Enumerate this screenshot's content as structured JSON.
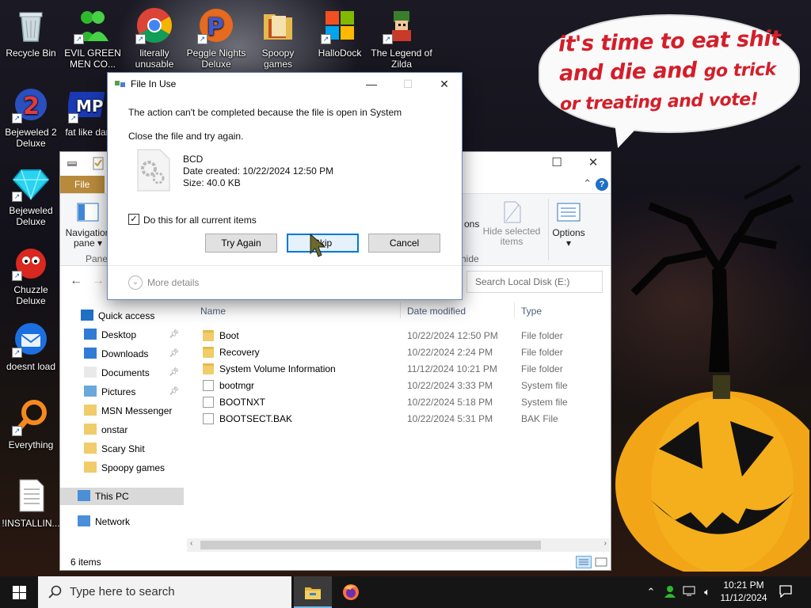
{
  "desktop": {
    "icons": [
      {
        "label": "Recycle Bin",
        "icon": "recycle-bin-icon"
      },
      {
        "label": "EVIL GREEN MEN CO...",
        "icon": "green-men-icon"
      },
      {
        "label": "literally unusable",
        "icon": "chrome-icon"
      },
      {
        "label": "Peggle Nights Deluxe",
        "icon": "peggle-icon"
      },
      {
        "label": "Spoopy games",
        "icon": "folder-icon"
      },
      {
        "label": "HalloDock",
        "icon": "windows-logo-icon"
      },
      {
        "label": "The Legend of Zilda",
        "icon": "zilda-icon"
      },
      {
        "label": "Bejeweled 2 Deluxe",
        "icon": "bejeweled2-icon"
      },
      {
        "label": "fat like dar",
        "icon": "mpi-icon"
      },
      {
        "label": "Bejeweled Deluxe",
        "icon": "bejeweled-icon"
      },
      {
        "label": "Chuzzle Deluxe",
        "icon": "chuzzle-icon"
      },
      {
        "label": "doesnt load",
        "icon": "thunderbird-icon"
      },
      {
        "label": "Everything",
        "icon": "everything-search-icon"
      },
      {
        "label": "!INSTALLIN...",
        "icon": "text-document-icon"
      }
    ],
    "wallpaper_caption_line1": "it's time to eat shit",
    "wallpaper_caption_line2a": "and die and",
    "wallpaper_caption_line2b": "go trick",
    "wallpaper_caption_line3": "or treating and vote!"
  },
  "explorer": {
    "file_tab": "File",
    "ribbon": {
      "nav_pane_line1": "Navigation",
      "nav_pane_line2": "pane ▾",
      "panes_group": "Panes",
      "options_partial": "ons",
      "hide_selected_line1": "Hide selected",
      "hide_selected_line2": "items",
      "hide_group_partial": "hide",
      "options": "Options"
    },
    "search_placeholder": "Search Local Disk (E:)",
    "columns": {
      "name": "Name",
      "date": "Date modified",
      "type": "Type"
    },
    "nav": {
      "quick_access": "Quick access",
      "items": [
        {
          "label": "Desktop",
          "pinned": true
        },
        {
          "label": "Downloads",
          "pinned": true
        },
        {
          "label": "Documents",
          "pinned": true
        },
        {
          "label": "Pictures",
          "pinned": true
        },
        {
          "label": "MSN Messenger",
          "pinned": false
        },
        {
          "label": "onstar",
          "pinned": false
        },
        {
          "label": "Scary Shit",
          "pinned": false
        },
        {
          "label": "Spoopy games",
          "pinned": false
        }
      ],
      "this_pc": "This PC",
      "network": "Network"
    },
    "files": [
      {
        "name": "Boot",
        "date": "10/22/2024 12:50 PM",
        "type": "File folder",
        "kind": "folder"
      },
      {
        "name": "Recovery",
        "date": "10/22/2024 2:24 PM",
        "type": "File folder",
        "kind": "folder"
      },
      {
        "name": "System Volume Information",
        "date": "11/12/2024 10:21 PM",
        "type": "File folder",
        "kind": "folder"
      },
      {
        "name": "bootmgr",
        "date": "10/22/2024 3:33 PM",
        "type": "System file",
        "kind": "file"
      },
      {
        "name": "BOOTNXT",
        "date": "10/22/2024 5:18 PM",
        "type": "System file",
        "kind": "file"
      },
      {
        "name": "BOOTSECT.BAK",
        "date": "10/22/2024 5:31 PM",
        "type": "BAK File",
        "kind": "file"
      }
    ],
    "status": "6 items"
  },
  "dialog": {
    "title": "File In Use",
    "message": "The action can't be completed because the file is open in System",
    "instruction": "Close the file and try again.",
    "file_name": "BCD",
    "date_created": "Date created: 10/22/2024 12:50 PM",
    "size": "Size: 40.0 KB",
    "checkbox_label": "Do this for all current items",
    "checkbox_checked": true,
    "btn_try_again": "Try Again",
    "btn_skip": "Skip",
    "btn_cancel": "Cancel",
    "more_details": "More details"
  },
  "taskbar": {
    "search_placeholder": "Type here to search",
    "time": "10:21 PM",
    "date": "11/12/2024"
  }
}
